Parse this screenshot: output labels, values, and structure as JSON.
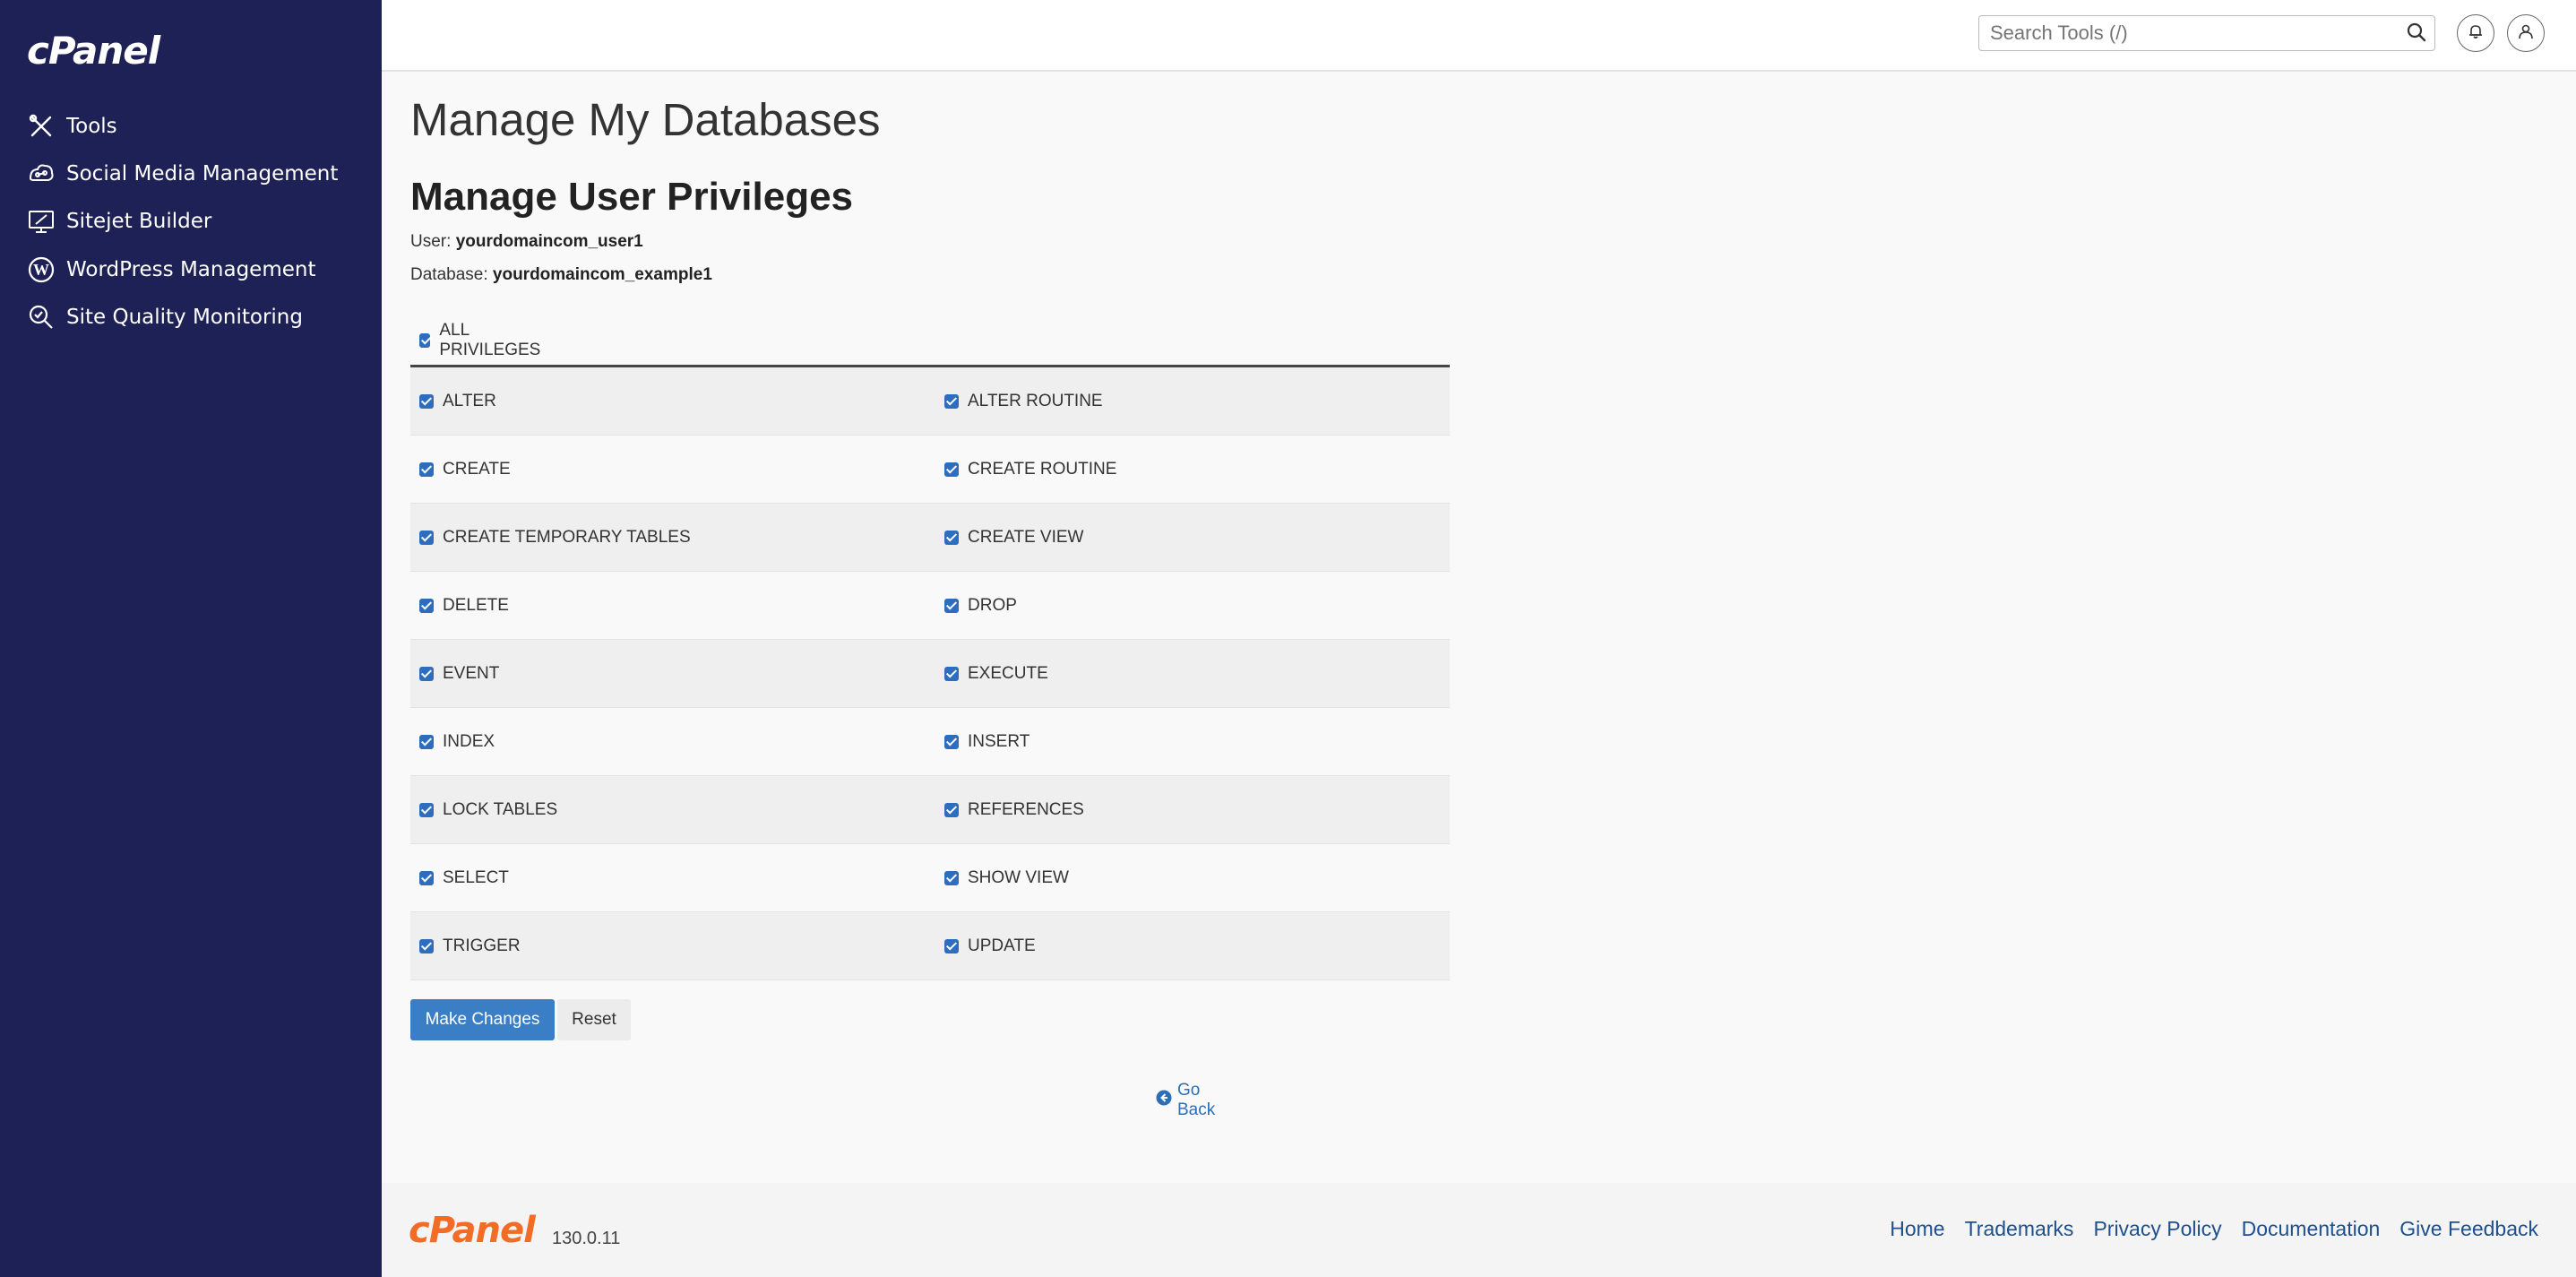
{
  "brand": {
    "logo": "cPanel",
    "version": "130.0.11"
  },
  "colors": {
    "sidebar_bg": "#1e2155",
    "primary": "#3a7ec6",
    "footer_logo": "#f26c25",
    "link": "#2a6fb8"
  },
  "sidebar": {
    "items": [
      {
        "label": "Tools",
        "icon": "tools-icon"
      },
      {
        "label": "Social Media Management",
        "icon": "social-media-icon"
      },
      {
        "label": "Sitejet Builder",
        "icon": "sitejet-icon"
      },
      {
        "label": "WordPress Management",
        "icon": "wordpress-icon"
      },
      {
        "label": "Site Quality Monitoring",
        "icon": "site-quality-icon"
      }
    ]
  },
  "header": {
    "search_placeholder": "Search Tools (/)"
  },
  "main": {
    "page_title": "Manage My Databases",
    "section_title": "Manage User Privileges",
    "user_label": "User:",
    "user_value": "yourdomaincom_user1",
    "db_label": "Database:",
    "db_value": "yourdomaincom_example1",
    "all_privileges": "ALL PRIVILEGES",
    "rows": [
      {
        "left": "ALTER",
        "right": "ALTER ROUTINE"
      },
      {
        "left": "CREATE",
        "right": "CREATE ROUTINE"
      },
      {
        "left": "CREATE TEMPORARY TABLES",
        "right": "CREATE VIEW"
      },
      {
        "left": "DELETE",
        "right": "DROP"
      },
      {
        "left": "EVENT",
        "right": "EXECUTE"
      },
      {
        "left": "INDEX",
        "right": "INSERT"
      },
      {
        "left": "LOCK TABLES",
        "right": "REFERENCES"
      },
      {
        "left": "SELECT",
        "right": "SHOW VIEW"
      },
      {
        "left": "TRIGGER",
        "right": "UPDATE"
      }
    ],
    "make_changes": "Make Changes",
    "reset": "Reset",
    "go_back": "Go Back"
  },
  "footer": {
    "links": [
      "Home",
      "Trademarks",
      "Privacy Policy",
      "Documentation",
      "Give Feedback"
    ]
  }
}
